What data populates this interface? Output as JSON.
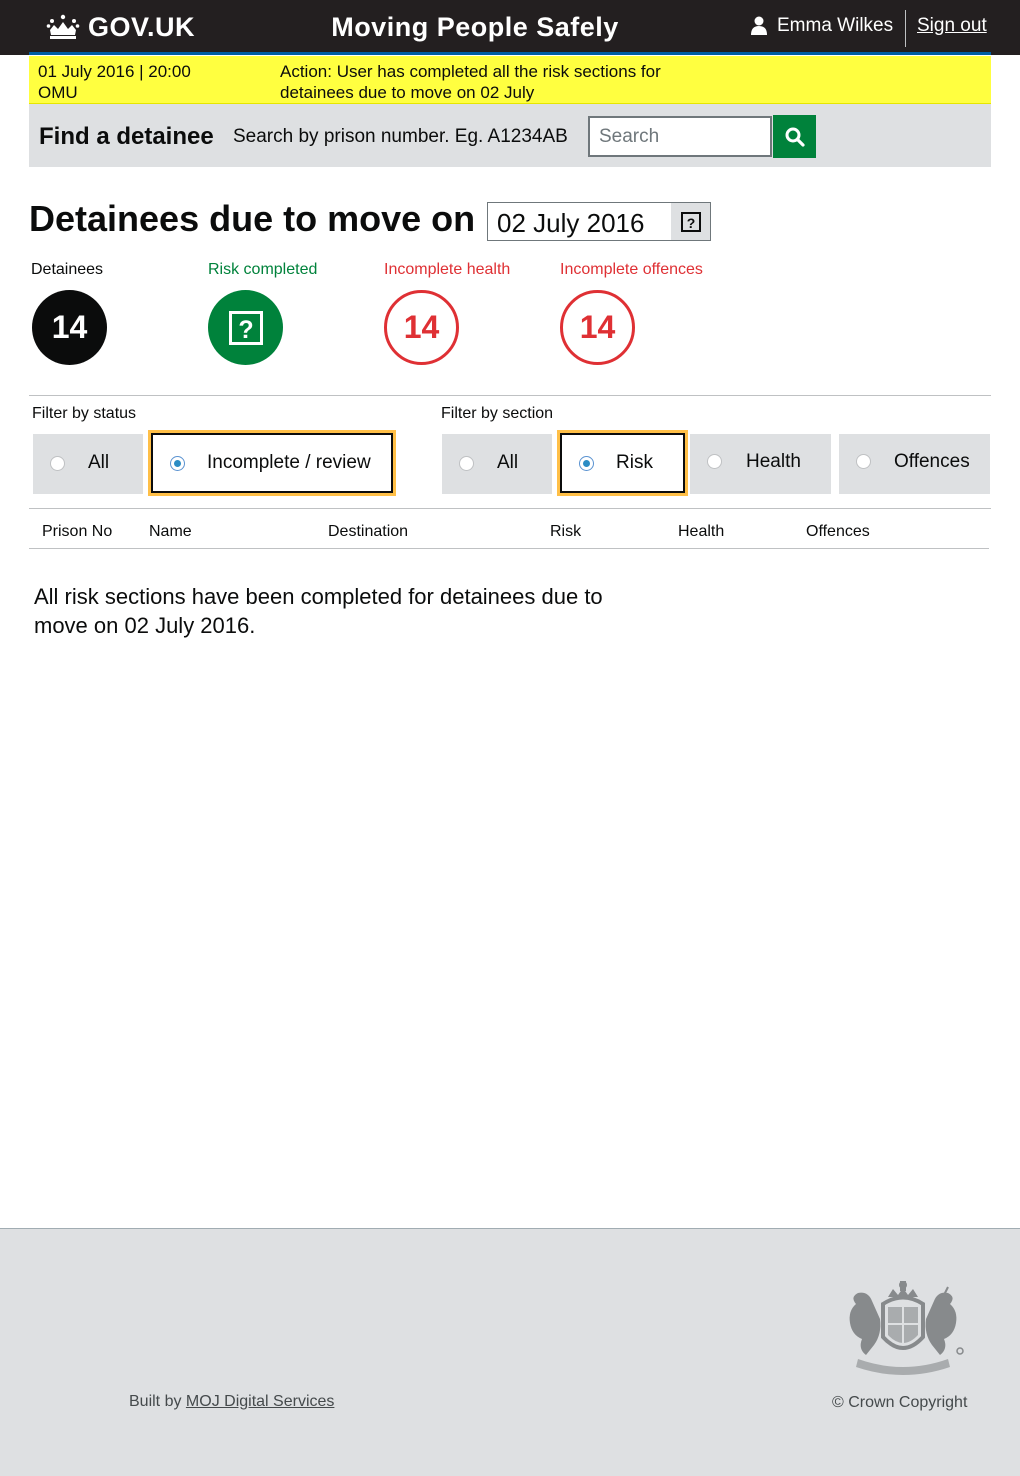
{
  "header": {
    "logo_text": "GOV.UK",
    "app_title": "Moving People Safely",
    "user_name": "Emma Wilkes",
    "sign_out": "Sign out"
  },
  "notice": {
    "timestamp": "01 July 2016 | 20:00",
    "location": "OMU",
    "action_line1": "Action: User has completed all the risk sections for",
    "action_line2": "detainees due to move on 02 July"
  },
  "find": {
    "title": "Find a detainee",
    "hint": "Search by prison number. Eg. A1234AB",
    "placeholder": "Search",
    "button_icon": "search-icon"
  },
  "main": {
    "heading": "Detainees due to move on",
    "date": "02 July 2016",
    "date_help_icon": "question-icon"
  },
  "stats": [
    {
      "label": "Detainees",
      "value": "14",
      "style": "black"
    },
    {
      "label": "Risk completed",
      "value": "?",
      "style": "green"
    },
    {
      "label": "Incomplete health",
      "value": "14",
      "style": "red"
    },
    {
      "label": "Incomplete offences",
      "value": "14",
      "style": "red"
    }
  ],
  "filters": {
    "status": {
      "label": "Filter by status",
      "options": [
        {
          "label": "All",
          "selected": false
        },
        {
          "label": "Incomplete / review",
          "selected": true
        }
      ]
    },
    "section": {
      "label": "Filter by section",
      "options": [
        {
          "label": "All",
          "selected": false
        },
        {
          "label": "Risk",
          "selected": true
        },
        {
          "label": "Health",
          "selected": false
        },
        {
          "label": "Offences",
          "selected": false
        }
      ]
    }
  },
  "table": {
    "columns": [
      "Prison No",
      "Name",
      "Destination",
      "Risk",
      "Health",
      "Offences"
    ]
  },
  "message": "All risk sections have been completed for detainees due to move on 02 July 2016.",
  "footer": {
    "built_by": "Built by",
    "built_link": "MOJ Digital Services",
    "copyright": "© Crown Copyright"
  },
  "colors": {
    "header_bg": "#231f20",
    "notice_bg": "#ffff40",
    "green": "#00823b",
    "red": "#df3034",
    "focus": "#ffbf47"
  }
}
